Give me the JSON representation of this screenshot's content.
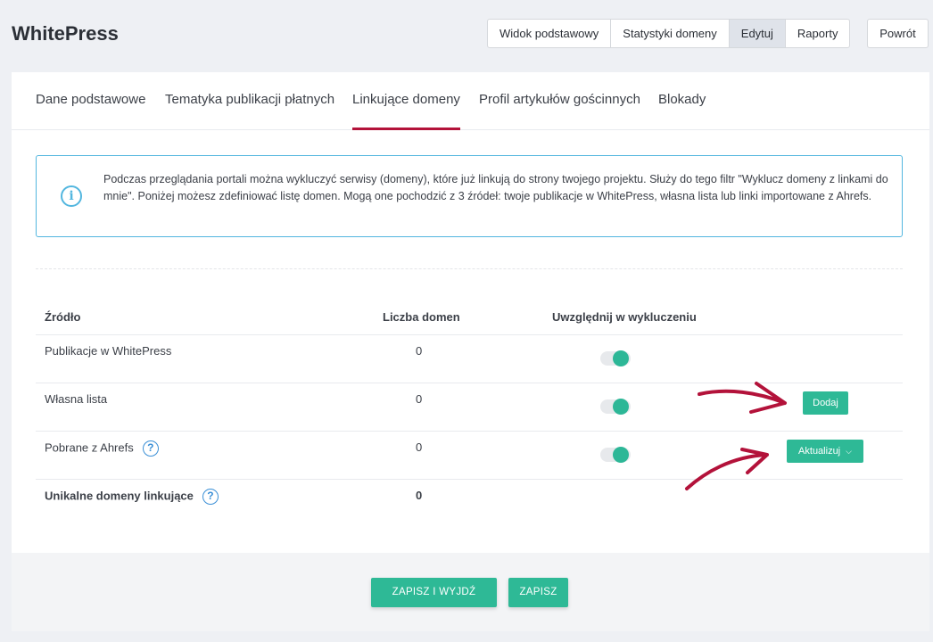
{
  "app": {
    "title": "WhitePress"
  },
  "view_buttons": [
    {
      "label": "Widok podstawowy",
      "active": false
    },
    {
      "label": "Statystyki domeny",
      "active": false
    },
    {
      "label": "Edytuj",
      "active": true
    },
    {
      "label": "Raporty",
      "active": false
    }
  ],
  "back_button": {
    "label": "Powrót"
  },
  "tabs": [
    {
      "label": "Dane podstawowe",
      "active": false
    },
    {
      "label": "Tematyka publikacji płatnych",
      "active": false
    },
    {
      "label": "Linkujące domeny",
      "active": true
    },
    {
      "label": "Profil artykułów gościnnych",
      "active": false
    },
    {
      "label": "Blokady",
      "active": false
    }
  ],
  "info": {
    "text": "Podczas przeglądania portali można wykluczyć serwisy (domeny), które już linkują do strony twojego projektu. Służy do tego filtr \"Wyklucz domeny z linkami do mnie\". Poniżej możesz zdefiniować listę domen. Mogą one pochodzić z 3 źródeł: twoje publikacje w WhitePress, własna lista lub linki importowane z Ahrefs."
  },
  "table": {
    "headers": {
      "source": "Źródło",
      "count": "Liczba domen",
      "include": "Uwzględnij w wykluczeniu"
    },
    "rows": [
      {
        "source": "Publikacje w WhitePress",
        "count": "0",
        "toggle_on": true
      },
      {
        "source": "Własna lista",
        "count": "0",
        "toggle_on": true,
        "action": "Dodaj"
      },
      {
        "source": "Pobrane z Ahrefs",
        "count": "0",
        "toggle_on": true,
        "action": "Aktualizuj",
        "help": "?"
      },
      {
        "source": "Unikalne domeny linkujące",
        "count": "0",
        "help": "?"
      }
    ]
  },
  "footer": {
    "save_exit": "ZAPISZ I WYJDŹ",
    "save": "ZAPISZ"
  },
  "colors": {
    "accent_green": "#2eb996",
    "tab_underline": "#b3123a",
    "info_border": "#52b6df",
    "arrow": "#b3123a"
  }
}
